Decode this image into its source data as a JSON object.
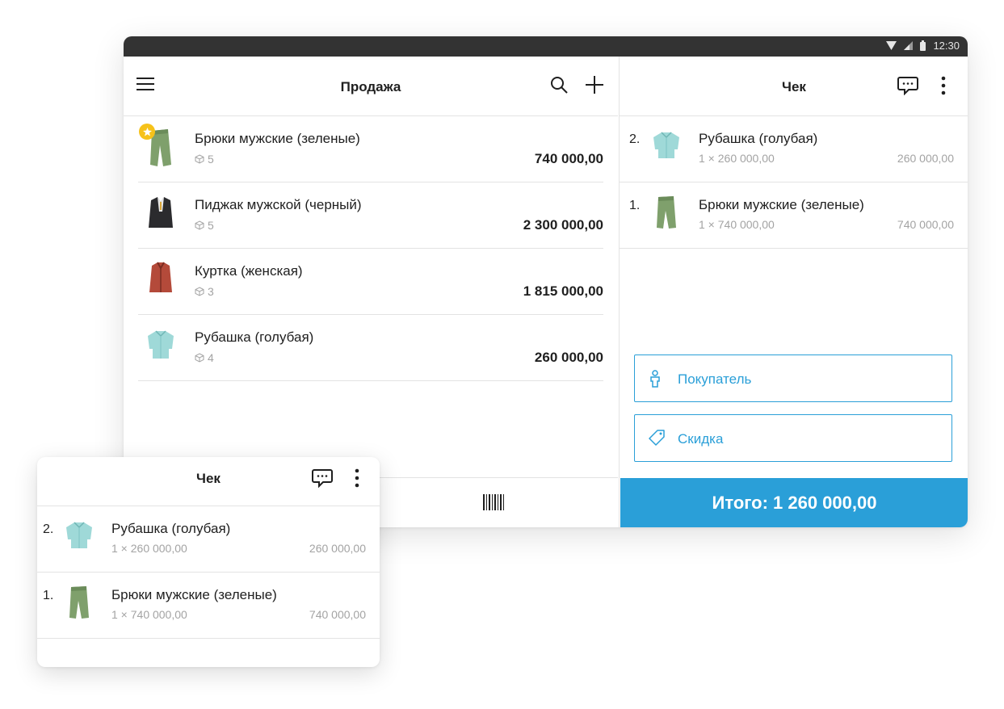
{
  "status_bar": {
    "time": "12:30"
  },
  "sale": {
    "title": "Продажа",
    "products": [
      {
        "name": "Брюки мужские (зеленые)",
        "stock": "5",
        "price": "740 000,00",
        "favorite": true,
        "thumb": "green-trousers"
      },
      {
        "name": "Пиджак мужской (черный)",
        "stock": "5",
        "price": "2 300 000,00",
        "favorite": false,
        "thumb": "black-jacket"
      },
      {
        "name": "Куртка (женская)",
        "stock": "3",
        "price": "1 815 000,00",
        "favorite": false,
        "thumb": "red-jacket"
      },
      {
        "name": "Рубашка (голубая)",
        "stock": "4",
        "price": "260 000,00",
        "favorite": false,
        "thumb": "blue-shirt"
      }
    ]
  },
  "receipt": {
    "title": "Чек",
    "items": [
      {
        "num": "2.",
        "name": "Рубашка (голубая)",
        "qty": "1 × 260 000,00",
        "sum": "260 000,00",
        "thumb": "blue-shirt"
      },
      {
        "num": "1.",
        "name": "Брюки мужские (зеленые)",
        "qty": "1 × 740 000,00",
        "sum": "740 000,00",
        "thumb": "green-trousers"
      }
    ],
    "buyer_label": "Покупатель",
    "discount_label": "Скидка",
    "total_label": "Итого: 1 260 000,00"
  },
  "colors": {
    "accent": "#2a9fd8",
    "status_bar": "#333333",
    "favorite_badge": "#f6c21a",
    "muted_text": "#a3a3a3"
  },
  "icons": {
    "menu": "hamburger-menu-icon",
    "search": "search-icon",
    "add": "plus-icon",
    "comment": "comment-icon",
    "more": "more-vertical-icon",
    "barcode": "barcode-icon",
    "buyer": "person-icon",
    "discount": "tag-icon",
    "stock": "box-icon"
  }
}
